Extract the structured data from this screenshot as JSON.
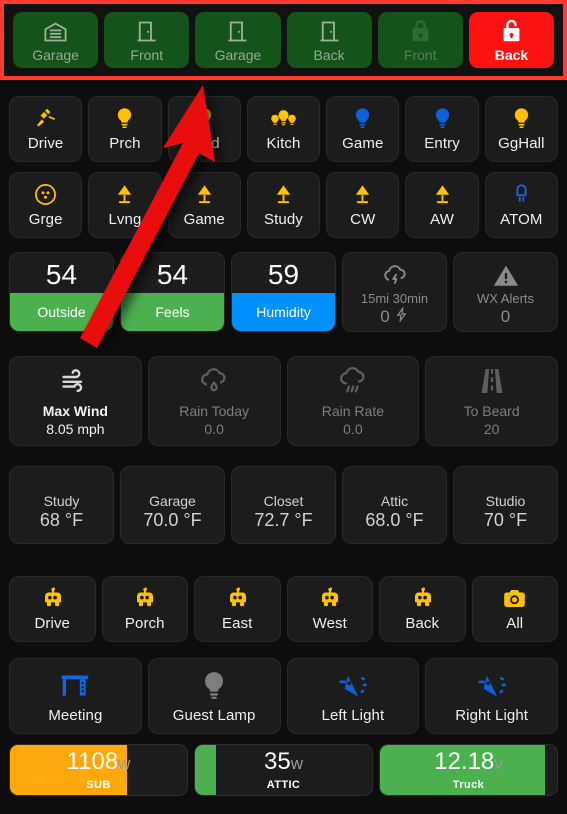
{
  "doors": {
    "items": [
      {
        "label": "Garage",
        "icon": "garage-door-icon",
        "state": "green"
      },
      {
        "label": "Front",
        "icon": "door-closed-icon",
        "state": "green"
      },
      {
        "label": "Garage",
        "icon": "door-closed-icon",
        "state": "green"
      },
      {
        "label": "Back",
        "icon": "door-closed-icon",
        "state": "green"
      },
      {
        "label": "Front",
        "icon": "lock-closed-icon",
        "state": "green-dim"
      },
      {
        "label": "Back",
        "icon": "lock-open-icon",
        "state": "red"
      }
    ]
  },
  "lights_row1": {
    "items": [
      {
        "label": "Drive",
        "icon": "flood-light-icon",
        "color": "#ffc107"
      },
      {
        "label": "Prch",
        "icon": "bulb-icon",
        "color": "#ffc107"
      },
      {
        "label": "Yard",
        "icon": "bulb-icon",
        "color": "#ffc107"
      },
      {
        "label": "Kitch",
        "icon": "bulb-group-icon",
        "color": "#ffc107"
      },
      {
        "label": "Game",
        "icon": "bulb-icon",
        "color": "#0a63d8"
      },
      {
        "label": "Entry",
        "icon": "bulb-icon",
        "color": "#0a63d8"
      },
      {
        "label": "GgHall",
        "icon": "bulb-icon",
        "color": "#ffc107"
      }
    ]
  },
  "lights_row2": {
    "items": [
      {
        "label": "Grge",
        "icon": "ceiling-fan-icon",
        "color": "#ffc107"
      },
      {
        "label": "Lvng",
        "icon": "lamp-icon",
        "color": "#ffc107"
      },
      {
        "label": "Game",
        "icon": "lamp-icon",
        "color": "#ffc107"
      },
      {
        "label": "Study",
        "icon": "lamp-icon",
        "color": "#ffc107"
      },
      {
        "label": "CW",
        "icon": "lamp-icon",
        "color": "#ffc107"
      },
      {
        "label": "AW",
        "icon": "lamp-icon",
        "color": "#ffc107"
      },
      {
        "label": "ATOM",
        "icon": "led-icon",
        "color": "#1565e0"
      }
    ]
  },
  "stats": {
    "outside": {
      "value": "54",
      "label": "Outside",
      "fill": "#4caf50"
    },
    "feels": {
      "value": "54",
      "label": "Feels",
      "fill": "#4caf50"
    },
    "humidity": {
      "value": "59",
      "label": "Humidity",
      "fill": "#0091ff"
    },
    "lightning": {
      "icon": "cloud-lightning-icon",
      "caption": "15mi 30min",
      "value": "0"
    },
    "wxalerts": {
      "icon": "alert-triangle-icon",
      "caption": "WX Alerts",
      "value": "0"
    }
  },
  "weather": {
    "items": [
      {
        "icon": "wind-icon",
        "title": "Max Wind",
        "value": "8.05 mph",
        "active": true
      },
      {
        "icon": "rain-drop-icon",
        "title": "Rain Today",
        "value": "0.0",
        "active": false
      },
      {
        "icon": "rain-heavy-icon",
        "title": "Rain Rate",
        "value": "0.0",
        "active": false
      },
      {
        "icon": "road-icon",
        "title": "To Beard",
        "value": "20",
        "active": false
      }
    ]
  },
  "temps": {
    "items": [
      {
        "name": "Study",
        "value": "68 °F"
      },
      {
        "name": "Garage",
        "value": "70.0 °F"
      },
      {
        "name": "Closet",
        "value": "72.7 °F"
      },
      {
        "name": "Attic",
        "value": "68.0 °F"
      },
      {
        "name": "Studio",
        "value": "70 °F"
      }
    ]
  },
  "cameras": {
    "items": [
      {
        "label": "Drive",
        "icon": "robot-icon",
        "color": "#ffc107"
      },
      {
        "label": "Porch",
        "icon": "robot-icon",
        "color": "#ffc107"
      },
      {
        "label": "East",
        "icon": "robot-icon",
        "color": "#ffc107"
      },
      {
        "label": "West",
        "icon": "robot-icon",
        "color": "#ffc107"
      },
      {
        "label": "Back",
        "icon": "robot-icon",
        "color": "#ffc107"
      },
      {
        "label": "All",
        "icon": "camera-icon",
        "color": "#ffc107"
      }
    ]
  },
  "scenes": {
    "items": [
      {
        "label": "Meeting",
        "icon": "desk-icon",
        "color": "#1565e0"
      },
      {
        "label": "Guest Lamp",
        "icon": "bulb-icon",
        "color": "#7d7d7d"
      },
      {
        "label": "Left Light",
        "icon": "wall-light-icon",
        "color": "#0a63d8"
      },
      {
        "label": "Right Light",
        "icon": "wall-light-icon",
        "color": "#0a63d8"
      }
    ]
  },
  "meters": {
    "items": [
      {
        "value": "1108",
        "unit": "w",
        "name": "SUB",
        "fill": "#ffa80b",
        "percent": 66
      },
      {
        "value": "35",
        "unit": "w",
        "name": "ATTIC",
        "fill": "#4caf50",
        "percent": 12
      },
      {
        "value": "12.18",
        "unit": "v",
        "name": "Truck",
        "fill": "#4caf50",
        "percent": 93
      }
    ]
  },
  "annotation": {
    "arrow": "red-arrow-pointer",
    "highlight_color": "#ff3b30"
  }
}
